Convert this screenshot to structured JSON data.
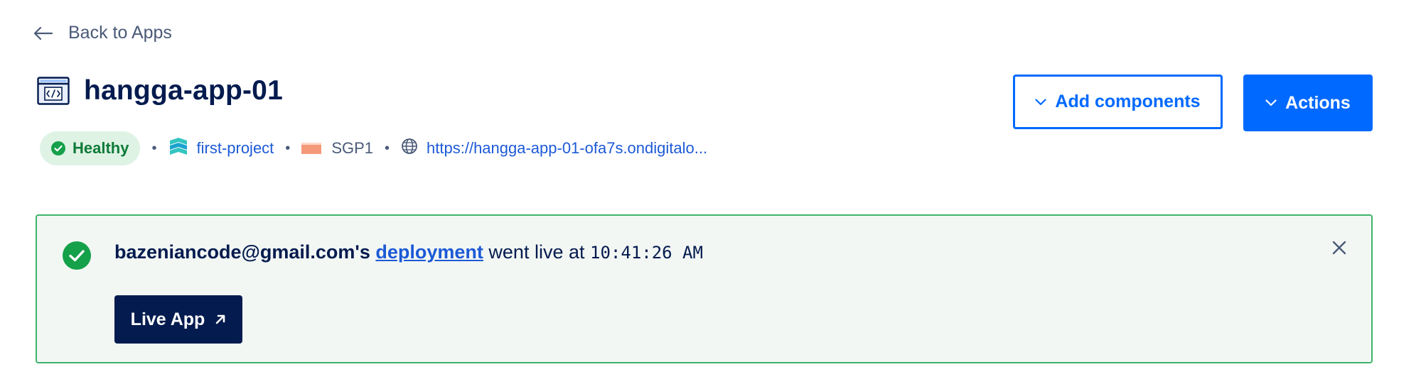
{
  "nav": {
    "back_label": "Back to Apps"
  },
  "app": {
    "name": "hangga-app-01",
    "status": "Healthy",
    "project": "first-project",
    "region": "SGP1",
    "url": "https://hangga-app-01-ofa7s.ondigitalo..."
  },
  "actions": {
    "add_components_label": "Add components",
    "actions_label": "Actions"
  },
  "notice": {
    "user": "bazeniancode@gmail.com's",
    "link_text": "deployment",
    "middle_text": "went live at",
    "time": "10:41:26 AM",
    "live_app_label": "Live App"
  },
  "icons": {
    "back": "arrow-left-icon",
    "app": "code-window-icon",
    "status": "check-circle-icon",
    "project": "project-icon",
    "region": "flag-icon",
    "url": "globe-icon",
    "dropdown": "chevron-down-icon",
    "close": "close-icon",
    "external": "arrow-up-right-icon"
  },
  "colors": {
    "primary": "#0069ff",
    "navy": "#031b4e",
    "success": "#3fb36b",
    "success_bg": "#f3f7f4",
    "healthy_badge_bg": "#dff3e5",
    "link": "#1d5ad6"
  }
}
